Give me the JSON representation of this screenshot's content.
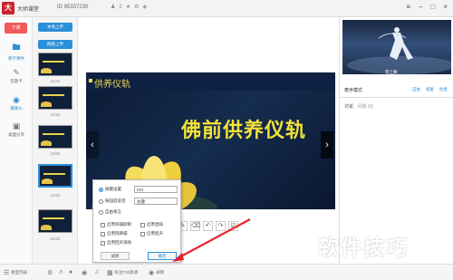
{
  "window": {
    "title": "大师课堂",
    "room_id": "ID 95337230",
    "people_count": "2"
  },
  "leftnav": {
    "exit_label": "下课",
    "items": [
      {
        "label": "教学课件",
        "icon": "folder-icon",
        "active": true
      },
      {
        "label": "答题卡",
        "icon": "answer-card-icon",
        "active": false
      },
      {
        "label": "摄像头",
        "icon": "camera-icon",
        "active": false
      },
      {
        "label": "桌面分享",
        "icon": "screen-share-icon",
        "active": false
      }
    ]
  },
  "thumbnails": {
    "upload_local": "本地上传",
    "upload_web": "网盘上传",
    "pages": [
      "11/31",
      "12/31",
      "13/31",
      "14/31",
      "15/31"
    ],
    "selected_index": 3
  },
  "slide": {
    "heading": "供养仪轨",
    "title": "佛前供养仪轨"
  },
  "popup": {
    "option_key_label": "按键设置",
    "option_key_value": "Ctrl",
    "option_voice_label": "按钮后说话",
    "option_voice_value": "左键",
    "option_free_label": "自由发言",
    "checks": [
      "启用风噪抑制",
      "启用混响",
      "启用风降噪",
      "启用变声",
      "启用回声消除"
    ],
    "btn_test": "试听",
    "btn_confirm": "确定"
  },
  "bottombar": {
    "teacher_list": "教室列表",
    "record": "录制",
    "quality": "标注720高清"
  },
  "rightpanel": {
    "video_caption": "雪上舞",
    "section_title": "麦序模式",
    "links": [
      "自由",
      "排麦",
      "抢麦"
    ],
    "discussion": "讨论",
    "qa": "问题 (0)"
  },
  "watermark": "软件技巧",
  "colors": {
    "accent": "#2b8fd9",
    "exit": "#f05a5a",
    "slide_title": "#f3e23a"
  }
}
